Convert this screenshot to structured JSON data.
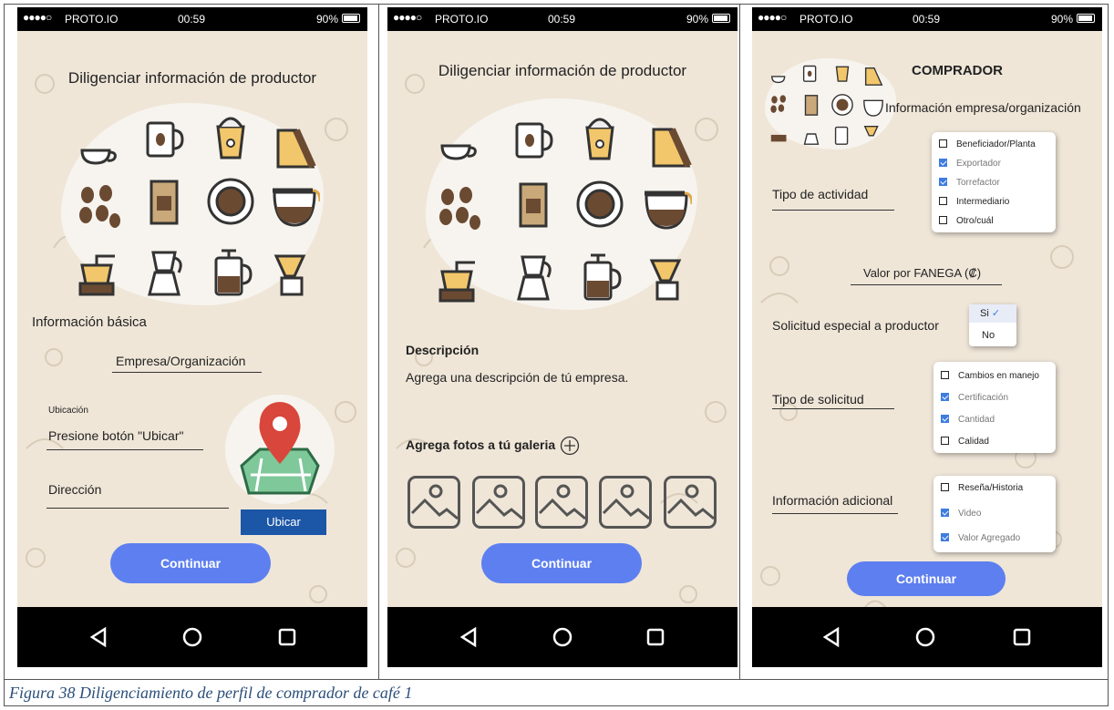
{
  "status_bar": {
    "signal": "●●●●○",
    "carrier": "PROTO.IO",
    "time": "00:59",
    "battery": "90%"
  },
  "screen1": {
    "title": "Diligenciar información de productor",
    "basic_info_label": "Información básica",
    "company_field": "Empresa/Organización",
    "location_label": "Ubicación",
    "location_field": "Presione botón \"Ubicar\"",
    "address_field": "Dirección",
    "locate_button": "Ubicar",
    "continue_button": "Continuar"
  },
  "screen2": {
    "title": "Diligenciar información de productor",
    "description_label": "Descripción",
    "description_text": "Agrega una descripción de tú empresa.",
    "gallery_label": "Agrega fotos a tú galeria",
    "continue_button": "Continuar"
  },
  "screen3": {
    "title": "COMPRADOR",
    "subtitle": "Información empresa/organización",
    "activity_label": "Tipo de actividad",
    "activity_options": [
      {
        "label": "Beneficiador/Planta",
        "checked": false
      },
      {
        "label": "Exportador",
        "checked": true
      },
      {
        "label": "Torrefactor",
        "checked": true
      },
      {
        "label": "Intermediario",
        "checked": false
      },
      {
        "label": "Otro/cuál",
        "checked": false
      }
    ],
    "price_label": "Valor por FANEGA (₡)",
    "special_request_label": "Solicitud especial a productor",
    "special_yes": "Si",
    "special_no": "No",
    "request_type_label": "Tipo de solicitud",
    "request_options": [
      {
        "label": "Cambios en manejo",
        "checked": false
      },
      {
        "label": "Certificación",
        "checked": true
      },
      {
        "label": "Cantidad",
        "checked": true
      },
      {
        "label": "Calidad",
        "checked": false
      }
    ],
    "additional_info_label": "Información adicional",
    "additional_options": [
      {
        "label": "Reseña/Historia",
        "checked": false
      },
      {
        "label": "Video",
        "checked": true
      },
      {
        "label": "Valor Agregado",
        "checked": true
      }
    ],
    "continue_button": "Continuar"
  },
  "caption": "Figura 38 Diligenciamiento de perfil de comprador de café 1",
  "colors": {
    "accent": "#5d7ff0",
    "ubicar": "#1c56a6",
    "checkbox": "#3f7ce0",
    "background": "#efe6d8"
  }
}
